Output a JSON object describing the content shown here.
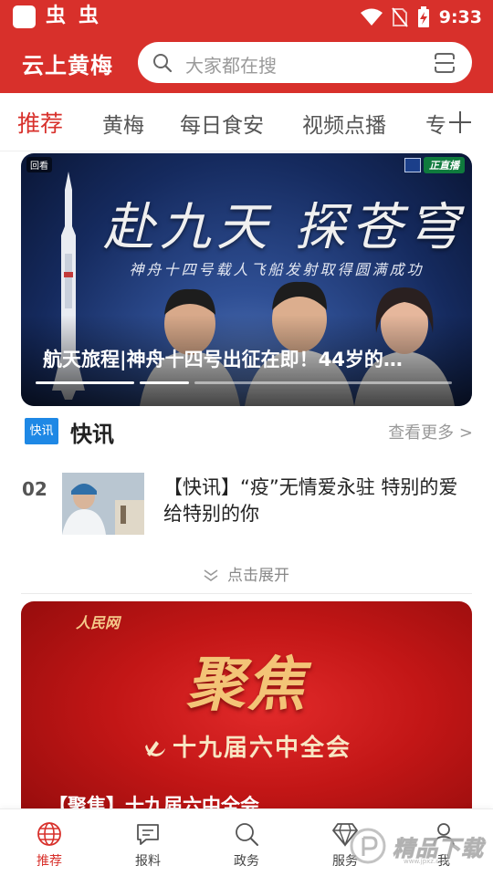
{
  "status_bar": {
    "time": "9:33",
    "app_icons": [
      "虫",
      "虫"
    ]
  },
  "header": {
    "app_title": "云上黄梅",
    "search_placeholder": "大家都在搜",
    "brand_color": "#d8302b"
  },
  "tabs": [
    {
      "label": "推荐",
      "active": true
    },
    {
      "label": "黄梅",
      "active": false
    },
    {
      "label": "每日食安",
      "active": false
    },
    {
      "label": "视频点播",
      "active": false
    },
    {
      "label": "专",
      "active": false
    }
  ],
  "hero": {
    "chip": "回看",
    "live_badge": "正直播",
    "headline": "赴九天 探苍穹",
    "subline": "神舟十四号载人飞船发射取得圆满成功",
    "caption": "航天旅程|神舟十四号出征在即！44岁的…"
  },
  "flash": {
    "logo": "快讯",
    "title": "快讯",
    "more": "查看更多 >",
    "item": {
      "rank": "02",
      "text": "【快讯】“疫”无情爱永驻  特别的爱给特别的你"
    },
    "expand_label": "点击展开"
  },
  "focus_banner": {
    "org_name": "人民网",
    "headline": "聚焦",
    "plenum": "十九届六中全会",
    "caption": "【聚焦】十九届六中全会"
  },
  "bottom_nav": [
    {
      "label": "推荐",
      "icon": "globe-icon",
      "active": true
    },
    {
      "label": "报料",
      "icon": "chat-icon",
      "active": false
    },
    {
      "label": "政务",
      "icon": "search-icon",
      "active": false
    },
    {
      "label": "服务",
      "icon": "diamond-icon",
      "active": false
    },
    {
      "label": "我",
      "icon": "user-icon",
      "active": false
    }
  ],
  "watermark": {
    "text": "精品下载",
    "url": "www.jpxz.com"
  }
}
